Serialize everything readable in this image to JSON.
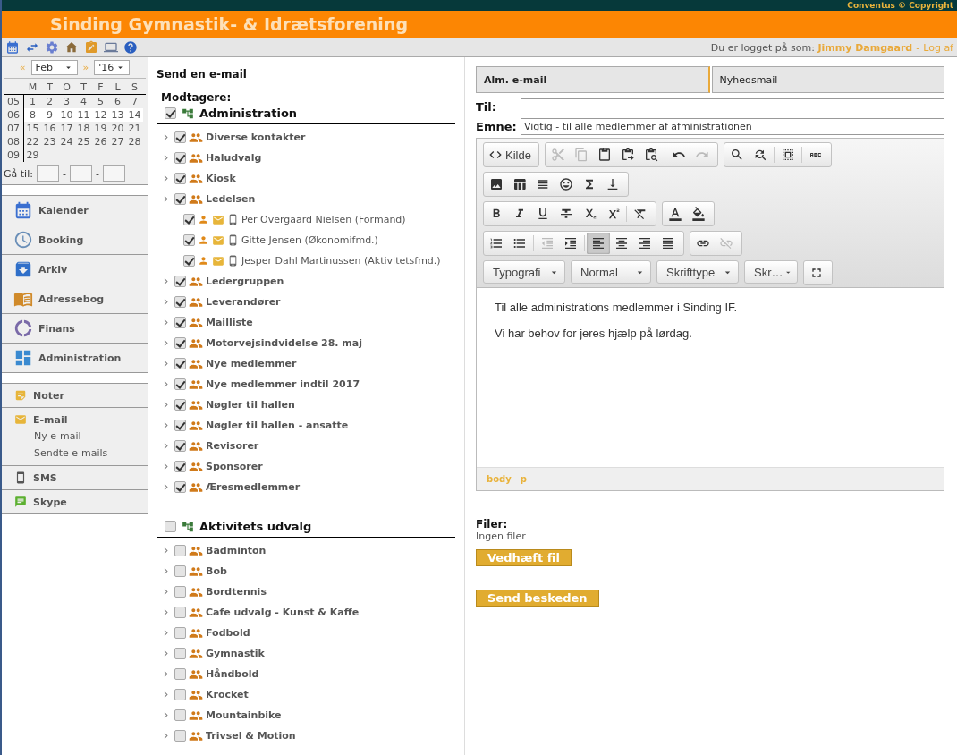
{
  "header": {
    "copyright": "Conventus © Copyright",
    "title": "Sinding Gymnastik- & Idrætsforening"
  },
  "topbar": {
    "login_label": "Du er logget på som:",
    "user_name": "Jimmy Damgaard",
    "separator": "-",
    "logout": "Log af"
  },
  "calendar": {
    "prev": "«",
    "month": "Feb",
    "next": "»",
    "year": "'16",
    "weekdays": [
      "M",
      "T",
      "O",
      "T",
      "F",
      "L",
      "S"
    ],
    "weeks": [
      {
        "number": "05",
        "selected": false,
        "days": [
          "1",
          "2",
          "3",
          "4",
          "5",
          "6",
          "7"
        ]
      },
      {
        "number": "06",
        "selected": true,
        "days": [
          "8",
          "9",
          "10",
          "11",
          "12",
          "13",
          "14"
        ]
      },
      {
        "number": "07",
        "selected": false,
        "days": [
          "15",
          "16",
          "17",
          "18",
          "19",
          "20",
          "21"
        ]
      },
      {
        "number": "08",
        "selected": false,
        "days": [
          "22",
          "23",
          "24",
          "25",
          "26",
          "27",
          "28"
        ]
      },
      {
        "number": "09",
        "selected": false,
        "days": [
          "29"
        ]
      }
    ],
    "goto_label": "Gå til:",
    "goto_separator": "-"
  },
  "nav": {
    "items": [
      {
        "kind": "calendar",
        "label": "Kalender"
      },
      {
        "kind": "booking",
        "label": "Booking"
      },
      {
        "kind": "archive",
        "label": "Arkiv"
      },
      {
        "kind": "book",
        "label": "Adressebog"
      },
      {
        "kind": "finance",
        "label": "Finans"
      },
      {
        "kind": "admin",
        "label": "Administration"
      }
    ],
    "tools": [
      {
        "kind": "notes",
        "label": "Noter"
      },
      {
        "kind": "mail",
        "label": "E-mail",
        "children": [
          "Ny e-mail",
          "Sendte e-mails"
        ]
      },
      {
        "kind": "sms",
        "label": "SMS"
      },
      {
        "kind": "chat",
        "label": "Skype"
      }
    ]
  },
  "page_title": "Send en e-mail",
  "recipients": {
    "label": "Modtagere:",
    "groups": [
      {
        "name": "Administration",
        "checked": true,
        "items": [
          {
            "name": "Diverse kontakter",
            "checked": true
          },
          {
            "name": "Haludvalg",
            "checked": true
          },
          {
            "name": "Kiosk",
            "checked": true
          },
          {
            "name": "Ledelsen",
            "checked": true,
            "children": [
              {
                "name": "Per Overgaard Nielsen (Formand)",
                "checked": true
              },
              {
                "name": "Gitte Jensen (Økonomifmd.)",
                "checked": true
              },
              {
                "name": "Jesper Dahl Martinussen (Aktivitetsfmd.)",
                "checked": true
              }
            ]
          },
          {
            "name": "Ledergruppen",
            "checked": true
          },
          {
            "name": "Leverandører",
            "checked": true
          },
          {
            "name": "Mailliste",
            "checked": true
          },
          {
            "name": "Motorvejsindvidelse 28. maj",
            "checked": true
          },
          {
            "name": "Nye medlemmer",
            "checked": true
          },
          {
            "name": "Nye medlemmer indtil 2017",
            "checked": true
          },
          {
            "name": "Nøgler til hallen",
            "checked": true
          },
          {
            "name": "Nøgler til hallen - ansatte",
            "checked": true
          },
          {
            "name": "Revisorer",
            "checked": true
          },
          {
            "name": "Sponsorer",
            "checked": true
          },
          {
            "name": "Æresmedlemmer",
            "checked": true
          }
        ]
      },
      {
        "name": "Aktivitets udvalg",
        "checked": false,
        "items": [
          {
            "name": "Badminton",
            "checked": false
          },
          {
            "name": "Bob",
            "checked": false
          },
          {
            "name": "Bordtennis",
            "checked": false
          },
          {
            "name": "Cafe udvalg - Kunst & Kaffe",
            "checked": false
          },
          {
            "name": "Fodbold",
            "checked": false
          },
          {
            "name": "Gymnastik",
            "checked": false
          },
          {
            "name": "Håndbold",
            "checked": false
          },
          {
            "name": "Krocket",
            "checked": false
          },
          {
            "name": "Mountainbike",
            "checked": false
          },
          {
            "name": "Trivsel & Motion",
            "checked": false
          }
        ]
      }
    ]
  },
  "tabs": [
    {
      "label": "Alm. e-mail",
      "selected": true
    },
    {
      "label": "Nyhedsmail",
      "selected": false
    }
  ],
  "to": {
    "label": "Til:"
  },
  "subject": {
    "label": "Emne:",
    "value": "Vigtig - til alle medlemmer af afministrationen"
  },
  "editor": {
    "toolbar_rows": [
      {
        "groups": [
          [
            {
              "kind": "source",
              "label": "Kilde",
              "disabled": false,
              "pressed": false
            }
          ],
          [
            {
              "kind": "cut",
              "disabled": true,
              "pressed": false
            },
            {
              "kind": "copy",
              "disabled": true,
              "pressed": false
            },
            {
              "kind": "paste",
              "disabled": false,
              "pressed": false
            },
            {
              "kind": "paste-text",
              "disabled": false,
              "pressed": false
            },
            {
              "kind": "paste-word",
              "disabled": false,
              "pressed": false
            },
            {
              "kind": "separator"
            },
            {
              "kind": "undo",
              "disabled": false,
              "pressed": false
            },
            {
              "kind": "redo",
              "disabled": true,
              "pressed": false
            }
          ],
          [
            {
              "kind": "find",
              "disabled": false,
              "pressed": false
            },
            {
              "kind": "replace",
              "disabled": false,
              "pressed": false
            },
            {
              "kind": "separator"
            },
            {
              "kind": "select-all",
              "disabled": false,
              "pressed": false
            },
            {
              "kind": "separator"
            },
            {
              "kind": "spelling",
              "disabled": false,
              "pressed": false
            }
          ]
        ]
      },
      {
        "groups": [
          [
            {
              "kind": "image",
              "disabled": false,
              "pressed": false
            },
            {
              "kind": "table",
              "disabled": false,
              "pressed": false
            },
            {
              "kind": "hr",
              "disabled": false,
              "pressed": false
            },
            {
              "kind": "smiley",
              "disabled": false,
              "pressed": false
            },
            {
              "kind": "special-char",
              "disabled": false,
              "pressed": false
            },
            {
              "kind": "page-break",
              "disabled": false,
              "pressed": false
            }
          ]
        ]
      },
      {
        "groups": [
          [
            {
              "kind": "bold",
              "disabled": false,
              "pressed": false
            },
            {
              "kind": "italic",
              "disabled": false,
              "pressed": false
            },
            {
              "kind": "underline",
              "disabled": false,
              "pressed": false
            },
            {
              "kind": "strike",
              "disabled": false,
              "pressed": false
            },
            {
              "kind": "subscript",
              "disabled": false,
              "pressed": false
            },
            {
              "kind": "superscript",
              "disabled": false,
              "pressed": false
            },
            {
              "kind": "separator"
            },
            {
              "kind": "remove-format",
              "disabled": false,
              "pressed": false
            }
          ],
          [
            {
              "kind": "text-color",
              "disabled": false,
              "pressed": false
            },
            {
              "kind": "bg-color",
              "disabled": false,
              "pressed": false
            }
          ]
        ]
      },
      {
        "groups": [
          [
            {
              "kind": "ordered-list",
              "disabled": false,
              "pressed": false
            },
            {
              "kind": "bullet-list",
              "disabled": false,
              "pressed": false
            },
            {
              "kind": "separator"
            },
            {
              "kind": "outdent",
              "disabled": true,
              "pressed": false
            },
            {
              "kind": "indent",
              "disabled": false,
              "pressed": false
            },
            {
              "kind": "separator"
            },
            {
              "kind": "align-left",
              "disabled": false,
              "pressed": true
            },
            {
              "kind": "align-center",
              "disabled": false,
              "pressed": false
            },
            {
              "kind": "align-right",
              "disabled": false,
              "pressed": false
            },
            {
              "kind": "justify",
              "disabled": false,
              "pressed": false
            }
          ],
          [
            {
              "kind": "link",
              "disabled": false,
              "pressed": false
            },
            {
              "kind": "unlink",
              "disabled": true,
              "pressed": false
            }
          ]
        ]
      }
    ],
    "combos": [
      "Typografi",
      "Normal",
      "Skrifttype",
      "Skr…"
    ],
    "paragraphs": [
      "Til alle administrations medlemmer i Sinding IF.",
      "Vi har behov for jeres hjælp på lørdag."
    ],
    "path": [
      "body",
      "p"
    ]
  },
  "files": {
    "label": "Filer:",
    "status": "Ingen filer",
    "attach_button": "Vedhæft fil"
  },
  "send_button": "Send beskeden"
}
